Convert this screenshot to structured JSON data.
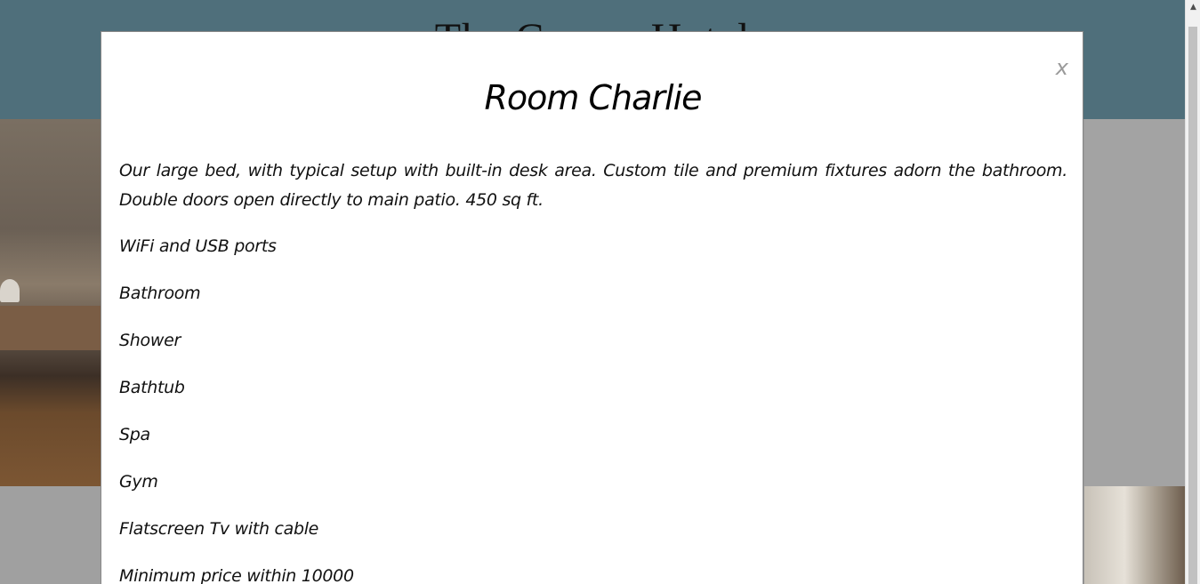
{
  "site": {
    "title": "The Corner Hotel"
  },
  "modal": {
    "close_label": "x",
    "title": "Room Charlie",
    "description": "Our large bed, with typical setup with built-in desk area. Custom tile and premium fixtures adorn the bathroom. Double doors open directly to main patio. 450 sq ft.",
    "amenities": [
      "WiFi and USB ports",
      "Bathroom",
      "Shower",
      "Bathtub",
      "Spa",
      "Gym",
      "Flatscreen Tv with cable",
      "Minimum price within 10000"
    ]
  },
  "scrollbar": {
    "up_arrow": "▲"
  },
  "colors": {
    "header_bg": "#4f6f7b",
    "modal_bg": "#ffffff",
    "close_color": "#9a9a9a",
    "backdrop": "#9a9a9a"
  }
}
